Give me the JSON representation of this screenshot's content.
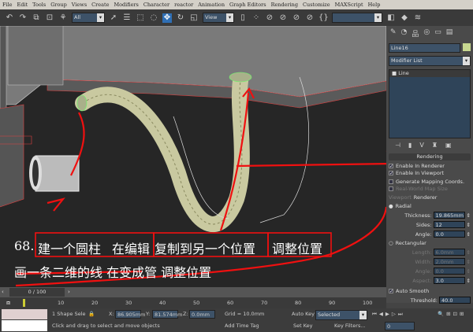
{
  "menu": [
    "File",
    "Edit",
    "Tools",
    "Group",
    "Views",
    "Create",
    "Modifiers",
    "Character",
    "reactor",
    "Animation",
    "Graph Editors",
    "Rendering",
    "Customize",
    "MAXScript",
    "Help"
  ],
  "toolbar": {
    "selection_filter": "All",
    "reference_coord": "View",
    "named_selection": ""
  },
  "annotations": {
    "line1_num": "68.",
    "line1_a": "建一个圆柱",
    "line1_b": "在编辑",
    "line1_c": "复制到另一个位置",
    "line1_d": "调整位置",
    "line2": "画一条二维的线 在变成管 调整位置"
  },
  "panel": {
    "object_name": "Line16",
    "modifier_list": "Modifier List",
    "stack_item": "Line",
    "rollout_title": "Rendering",
    "enable_renderer": "Enable In Renderer",
    "enable_viewport": "Enable In Viewport",
    "gen_mapping": "Generate Mapping Coords.",
    "real_world": "Real-World Map Size",
    "viewport_radio": "Viewport",
    "renderer_radio": "Renderer",
    "radial": "Radial",
    "thickness_label": "Thickness:",
    "thickness": "19.865mm",
    "sides_label": "Sides:",
    "sides": "12",
    "angle_label": "Angle:",
    "angle": "0.0",
    "rectangular": "Rectangular",
    "length_label": "Length:",
    "length": "6.0mm",
    "width_label": "Width:",
    "width": "2.0mm",
    "angle2_label": "Angle:",
    "angle2": "0.0",
    "aspect_label": "Aspect:",
    "aspect": "3.0",
    "auto_smooth": "Auto Smooth",
    "threshold_label": "Threshold:",
    "threshold": "40.0",
    "object_color": "#c8d890"
  },
  "timeline": {
    "frame": "0 / 100",
    "ticks": [
      "0",
      "10",
      "20",
      "30",
      "40",
      "50",
      "60",
      "70",
      "80",
      "90",
      "100"
    ]
  },
  "status": {
    "selection": "1 Shape Sele",
    "x_label": "X:",
    "x": "86.905mm",
    "y_label": "Y:",
    "y": "81.574mm",
    "z_label": "Z:",
    "z": "0.0mm",
    "grid": "Grid = 10.0mm",
    "prompt": "Click and drag to select and move objects",
    "add_time_tag": "Add Time Tag",
    "auto_key": "Auto Key",
    "set_key": "Set Key",
    "key_mode": "Selected",
    "key_filters": "Key Filters...",
    "current_frame": "0"
  }
}
